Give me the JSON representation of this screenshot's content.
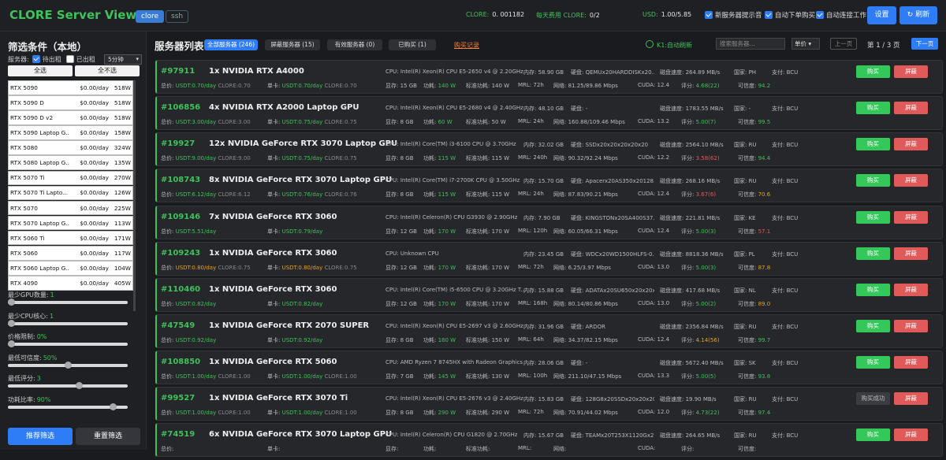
{
  "header": {
    "title": "CLORE Server Viewer",
    "tags": [
      "clore",
      "ssh"
    ],
    "stats": [
      {
        "k": "CLORE:",
        "v": "0. 001182"
      },
      {
        "k": "每天费用 CLORE:",
        "v": "0/2"
      },
      {
        "k": "USD:",
        "v": "1.00/5.85"
      }
    ],
    "checks": [
      "新服务器提示音",
      "自动下单购买",
      "自动连接工作"
    ],
    "settings": "设置",
    "refresh": "↻ 刷新"
  },
  "sidebar": {
    "title": "筛选条件（本地）",
    "server_label": "服务器:",
    "check_rented": "待出租",
    "check_out": "已出租",
    "interval": "5分钟",
    "select_all": "全选",
    "select_none": "全不选",
    "gpus": [
      {
        "n": "RTX 5090",
        "p": "$0.00/day",
        "w": "518W"
      },
      {
        "n": "RTX 5090 D",
        "p": "$0.00/day",
        "w": "518W"
      },
      {
        "n": "RTX 5090 D v2",
        "p": "$0.00/day",
        "w": "518W"
      },
      {
        "n": "RTX 5090 Laptop G...",
        "p": "$0.00/day",
        "w": "158W"
      },
      {
        "n": "RTX 5080",
        "p": "$0.00/day",
        "w": "324W"
      },
      {
        "n": "RTX 5080 Laptop G...",
        "p": "$0.00/day",
        "w": "135W"
      },
      {
        "n": "RTX 5070 Ti",
        "p": "$0.00/day",
        "w": "270W"
      },
      {
        "n": "RTX 5070 Ti Lapto...",
        "p": "$0.00/day",
        "w": "126W"
      },
      {
        "n": "RTX 5070",
        "p": "$0.00/day",
        "w": "225W"
      },
      {
        "n": "RTX 5070 Laptop G...",
        "p": "$0.00/day",
        "w": "113W"
      },
      {
        "n": "RTX 5060 Ti",
        "p": "$0.00/day",
        "w": "171W"
      },
      {
        "n": "RTX 5060",
        "p": "$0.00/day",
        "w": "117W"
      },
      {
        "n": "RTX 5060 Laptop G...",
        "p": "$0.00/day",
        "w": "104W"
      },
      {
        "n": "RTX 4090",
        "p": "$0.00/day",
        "w": "405W"
      }
    ],
    "sliders": [
      {
        "label": "最少GPU数量:",
        "v": "1",
        "frac": 0.0
      },
      {
        "label": "最少CPU核心:",
        "v": "1",
        "frac": 0.0
      },
      {
        "label": "价格限制:",
        "v": "0%",
        "frac": 0.0
      },
      {
        "label": "最低可信度:",
        "v": "50%",
        "frac": 0.5
      },
      {
        "label": "最低评分:",
        "v": "3",
        "frac": 0.6
      },
      {
        "label": "功耗比率:",
        "v": "90%",
        "frac": 0.9
      }
    ],
    "recommend": "推荐筛选",
    "reset": "重置筛选"
  },
  "main": {
    "title": "服务器列表",
    "tabs": [
      "全部服务器 (246)",
      "屏蔽服务器 (15)",
      "有效服务器 (0)",
      "已购买 (1)"
    ],
    "record": "购买记录",
    "auto": "K1:自动刷新",
    "search_placeholder": "搜索服务器...",
    "sort": "单价",
    "prev": "上一页",
    "page": "第 1 / 3 页",
    "next": "下一页",
    "buy": "购买",
    "block": "屏蔽",
    "cards": [
      {
        "id": "#97911",
        "name": "1x NVIDIA RTX A4000",
        "cpu": "CPU: Intel(R) Xeon(R) CPU E5-2650 v4 @ 2.20GHz",
        "mem": "内存: 58.90 GB",
        "disk": "硬盘: QEMUx20HARDDISKx20...",
        "speed": "磁盘速度: 264.89 MB/s",
        "country": "国家: PH",
        "pay": "支付: BCU",
        "total": "USDT:0.70/day",
        "total_clore": "CLORE:0.70",
        "unit": "USDT:0.70/day",
        "unit_clore": "CLORE:0.70",
        "vram": "15 GB",
        "power": "140 W",
        "std": "140 W",
        "mrl": "72h",
        "net": "81.25/89.86 Mbps",
        "cuda": "12.4",
        "score": "4.68(22)",
        "trust": "94.2",
        "sc": "g",
        "tc": "g",
        "pc": "g"
      },
      {
        "id": "#106856",
        "name": "4x NVIDIA RTX A2000 Laptop GPU",
        "cpu": "CPU: Intel(R) Xeon(R) CPU E5-2680 v4 @ 2.40GHz",
        "mem": "内存: 48.10 GB",
        "disk": "硬盘: -",
        "speed": "磁盘速度: 1783.55 MB/s",
        "country": "国家: -",
        "pay": "支付: BCU",
        "total": "USDT:3.00/day",
        "total_clore": "CLORE:3.00",
        "unit": "USDT:0.75/day",
        "unit_clore": "CLORE:0.75",
        "vram": "8 GB",
        "power": "60 W",
        "std": "50 W",
        "mrl": "24h",
        "net": "160.88/109.46 Mbps",
        "cuda": "13.2",
        "score": "5.00(7)",
        "trust": "99.5",
        "sc": "g",
        "tc": "g",
        "pc": "g"
      },
      {
        "id": "#19927",
        "name": "12x NVIDIA GeForce RTX 3070 Laptop GPU",
        "cpu": "CPU: Intel(R) Core(TM) i3-6100 CPU @ 3.70GHz",
        "mem": "内存: 32.02 GB",
        "disk": "硬盘: SSDx20x20x20x20x20",
        "speed": "磁盘速度: 2564.10 MB/s",
        "country": "国家: RU",
        "pay": "支付: BCU",
        "total": "USDT:9.00/day",
        "total_clore": "CLORE:9.00",
        "unit": "USDT:0.75/day",
        "unit_clore": "CLORE:0.75",
        "vram": "8 GB",
        "power": "115 W",
        "std": "115 W",
        "mrl": "240h",
        "net": "90.32/92.24 Mbps",
        "cuda": "12.2",
        "score": "3.58(62)",
        "trust": "94.4",
        "sc": "r",
        "tc": "g",
        "pc": "o"
      },
      {
        "id": "#108743",
        "name": "8x NVIDIA GeForce RTX 3070 Laptop GPU",
        "cpu": "CPU: Intel(R) Core(TM) i7-2700K CPU @ 3.50GHz",
        "mem": "内存: 15.70 GB",
        "disk": "硬盘: Apacerx20AS350x20128...",
        "speed": "磁盘速度: 268.16 MB/s",
        "country": "国家: RU",
        "pay": "支付: BCU",
        "total": "USDT:6.12/day",
        "total_clore": "CLORE:6.12",
        "unit": "USDT:0.76/day",
        "unit_clore": "CLORE:0.76",
        "vram": "8 GB",
        "power": "115 W",
        "std": "115 W",
        "mrl": "24h",
        "net": "87.83/90.21 Mbps",
        "cuda": "12.4",
        "score": "3.67(6)",
        "trust": "70.6",
        "sc": "r",
        "tc": "o",
        "pc": "o"
      },
      {
        "id": "#109146",
        "name": "7x NVIDIA GeForce RTX 3060",
        "cpu": "CPU: Intel(R) Celeron(R) CPU G3930 @ 2.90GHz",
        "mem": "内存: 7.90 GB",
        "disk": "硬盘: KINGSTONx20SA400S37...",
        "speed": "磁盘速度: 221.81 MB/s",
        "country": "国家: KE",
        "pay": "支付: BCU",
        "total": "USDT:5.51/day",
        "total_clore": "",
        "unit": "USDT:0.79/day",
        "unit_clore": "",
        "vram": "12 GB",
        "power": "170 W",
        "std": "170 W",
        "mrl": "120h",
        "net": "60.05/66.31 Mbps",
        "cuda": "12.4",
        "score": "5.00(3)",
        "trust": "57.1",
        "sc": "g",
        "tc": "r",
        "pc": "o"
      },
      {
        "id": "#109243",
        "name": "1x NVIDIA GeForce RTX 3060",
        "cpu": "CPU: Unknown CPU",
        "mem": "内存: 23.45 GB",
        "disk": "硬盘: WDCx20WD1500HLFS-0...",
        "speed": "磁盘速度: 8818.36 MB/s",
        "country": "国家: PL",
        "pay": "支付: BCU",
        "total": "USDT:0.80/day",
        "total_clore": "CLORE:0.75",
        "unit": "USDT:0.80/day",
        "unit_clore": "CLORE:0.75",
        "vram": "12 GB",
        "power": "170 W",
        "std": "170 W",
        "mrl": "72h",
        "net": "6.25/3.97 Mbps",
        "cuda": "13.0",
        "score": "5.00(3)",
        "trust": "87.8",
        "sc": "g",
        "tc": "o",
        "pc": "y"
      },
      {
        "id": "#110460",
        "name": "1x NVIDIA GeForce RTX 3060",
        "cpu": "CPU: Intel(R) Core(TM) i5-6500 CPU @ 3.20GHz T...",
        "mem": "内存: 15.88 GB",
        "disk": "硬盘: ADATAx20SU650x20x20x",
        "speed": "磁盘速度: 417.68 MB/s",
        "country": "国家: NL",
        "pay": "支付: BCU",
        "total": "USDT:0.82/day",
        "total_clore": "",
        "unit": "USDT:0.82/day",
        "unit_clore": "",
        "vram": "12 GB",
        "power": "170 W",
        "std": "170 W",
        "mrl": "168h",
        "net": "80.14/80.86 Mbps",
        "cuda": "13.0",
        "score": "5.00(2)",
        "trust": "89.0",
        "sc": "g",
        "tc": "o",
        "pc": "g"
      },
      {
        "id": "#47549",
        "name": "1x NVIDIA GeForce RTX 2070 SUPER",
        "cpu": "CPU: Intel(R) Xeon(R) CPU E5-2697 v3 @ 2.60GHz",
        "mem": "内存: 31.96 GB",
        "disk": "硬盘: ARDOR",
        "speed": "磁盘速度: 2356.84 MB/s",
        "country": "国家: RU",
        "pay": "支付: BCU",
        "total": "USDT:0.92/day",
        "total_clore": "",
        "unit": "USDT:0.92/day",
        "unit_clore": "",
        "vram": "8 GB",
        "power": "180 W",
        "std": "150 W",
        "mrl": "64h",
        "net": "34.37/82.15 Mbps",
        "cuda": "12.4",
        "score": "4.14(56)",
        "trust": "99.7",
        "sc": "y",
        "tc": "g",
        "pc": "g"
      },
      {
        "id": "#108850",
        "name": "1x NVIDIA GeForce RTX 5060",
        "cpu": "CPU: AMD Ryzen 7 8745HX with Radeon Graphics",
        "mem": "内存: 28.06 GB",
        "disk": "硬盘: -",
        "speed": "磁盘速度: 5672.40 MB/s",
        "country": "国家: SK",
        "pay": "支付: BCU",
        "total": "USDT:1.00/day",
        "total_clore": "CLORE:1.00",
        "unit": "USDT:1.00/day",
        "unit_clore": "CLORE:1.00",
        "vram": "7 GB",
        "power": "145 W",
        "std": "130 W",
        "mrl": "100h",
        "net": "211.10/47.15 Mbps",
        "cuda": "13.3",
        "score": "5.00(5)",
        "trust": "93.8",
        "sc": "g",
        "tc": "g",
        "pc": "g"
      },
      {
        "id": "#99527",
        "name": "1x NVIDIA GeForce RTX 3070 Ti",
        "cpu": "CPU: Intel(R) Xeon(R) CPU E5-2676 v3 @ 2.40GHz",
        "mem": "内存: 15.83 GB",
        "disk": "硬盘: 128G8x20SSDx20x20x20",
        "speed": "磁盘速度: 19.90 MB/s",
        "country": "国家: RU",
        "pay": "支付: BCU",
        "total": "USDT:1.00/day",
        "total_clore": "CLORE:1.00",
        "unit": "USDT:1.00/day",
        "unit_clore": "CLORE:1.00",
        "vram": "8 GB",
        "power": "290 W",
        "std": "290 W",
        "mrl": "72h",
        "net": "70.91/44.02 Mbps",
        "cuda": "12.0",
        "score": "4.73(22)",
        "trust": "97.4",
        "sc": "g",
        "tc": "g",
        "pc": "g",
        "bought": true
      },
      {
        "id": "#74519",
        "name": "6x NVIDIA GeForce RTX 3070 Laptop GPU",
        "cpu": "CPU: Intel(R) Celeron(R) CPU G1820 @ 2.70GHz",
        "mem": "内存: 15.67 GB",
        "disk": "硬盘: TEAMx20T253X1120Gx2...",
        "speed": "磁盘速度: 264.65 MB/s",
        "country": "国家: RU",
        "pay": "支付: BCU",
        "total": "",
        "total_clore": "",
        "unit": "",
        "unit_clore": "",
        "vram": "",
        "power": "",
        "std": "",
        "mrl": "",
        "net": "",
        "cuda": "",
        "score": "",
        "trust": "",
        "sc": "g",
        "tc": "g",
        "pc": "g"
      }
    ],
    "bought_label": "购买成功",
    "labels": {
      "total": "总价:",
      "unit": "单卡:",
      "vram": "显存:",
      "power": "功耗:",
      "std": "标准功耗:",
      "mrl": "MRL:",
      "net": "网络:",
      "cuda": "CUDA:",
      "score": "评分:",
      "trust": "可信度:"
    }
  },
  "colors": {
    "accent": "#3ec25a",
    "primary": "#2f7df6",
    "danger": "#e05a5a",
    "warn": "#e8a317"
  }
}
